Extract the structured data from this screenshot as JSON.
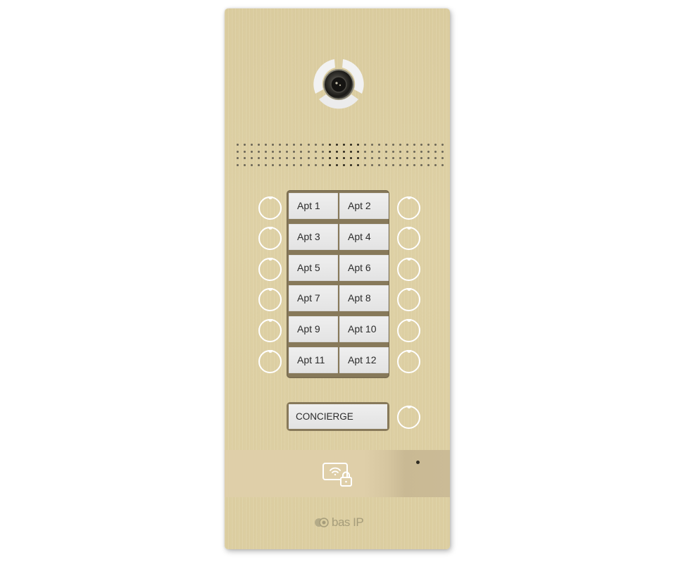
{
  "device": {
    "type": "multi-apartment door intercom panel",
    "finish_color": "#dccd9f",
    "label_frame_color": "#87795a"
  },
  "camera": {
    "icon": "camera-lens-icon"
  },
  "speaker": {
    "icon": "speaker-grille",
    "columns": 30,
    "rows": 4
  },
  "apartments": [
    {
      "label": "Apt 1"
    },
    {
      "label": "Apt 2"
    },
    {
      "label": "Apt 3"
    },
    {
      "label": "Apt 4"
    },
    {
      "label": "Apt 5"
    },
    {
      "label": "Apt 6"
    },
    {
      "label": "Apt 7"
    },
    {
      "label": "Apt 8"
    },
    {
      "label": "Apt 9"
    },
    {
      "label": "Apt 10"
    },
    {
      "label": "Apt 11"
    },
    {
      "label": "Apt 12"
    }
  ],
  "concierge": {
    "label": "CONCIERGE"
  },
  "reader": {
    "icon": "rfid-card-lock-icon",
    "mic_icon": "microphone-dot"
  },
  "brand": {
    "logo_text": "bas IP"
  }
}
